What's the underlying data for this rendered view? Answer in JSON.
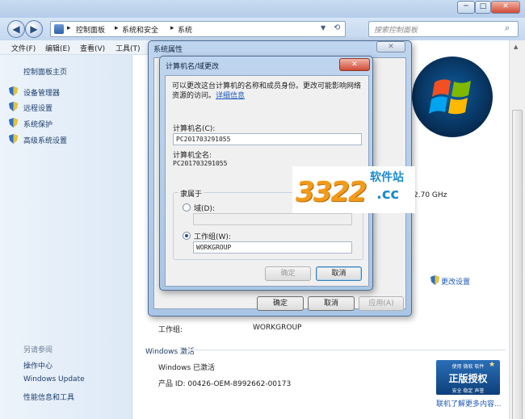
{
  "window": {
    "address_parts": [
      "控制面板",
      "系统和安全",
      "系统"
    ],
    "search_placeholder": "搜索控制面板",
    "min_label": "─",
    "max_label": "□",
    "close_label": "✕"
  },
  "menu": [
    "文件(F)",
    "编辑(E)",
    "查看(V)",
    "工具(T)"
  ],
  "sidebar": {
    "home": "控制面板主页",
    "links": [
      "设备管理器",
      "远程设置",
      "系统保护",
      "高级系统设置"
    ],
    "see_also_title": "另请参阅",
    "see_also": [
      "操作中心",
      "Windows Update",
      "性能信息和工具"
    ]
  },
  "main": {
    "cpu_suffix": "2.70 GHz",
    "change_settings": "更改设置",
    "workgroup_label": "工作组:",
    "workgroup_value": "WORKGROUP",
    "activation_heading": "Windows 激活",
    "activation_status": "Windows 已激活",
    "product_id": "产品 ID: 00426-OEM-8992662-00173",
    "genuine_badge_top": "使用 微软 软件",
    "genuine_badge_main": "正版授权",
    "genuine_badge_bottom": "安全 稳定 声誉",
    "genuine_link": "联机了解更多内容..."
  },
  "system_properties": {
    "title": "系统属性",
    "ok": "确定",
    "cancel": "取消",
    "apply": "应用(A)"
  },
  "rename_dialog": {
    "title": "计算机名/域更改",
    "description": "可以更改这台计算机的名称和成员身份。更改可能影响网络资源的访问。",
    "details_link": "详细信息",
    "name_label": "计算机名(C):",
    "name_value": "PC201703291055",
    "full_name_label": "计算机全名:",
    "full_name_value": "PC201703291055",
    "member_of_label": "隶属于",
    "domain_label": "域(D):",
    "domain_value": "",
    "workgroup_label": "工作组(W):",
    "workgroup_value": "WORKGROUP",
    "ok": "确定",
    "cancel": "取消",
    "close_label": "✕"
  },
  "watermark": {
    "digits": "3322",
    "cn_text": "软件站",
    "domain_text": ".cc"
  },
  "colors": {
    "link": "#1b58b8",
    "sidebar_text": "#1b3d6b",
    "watermark_orange": "#f29a1a",
    "watermark_blue": "#1a8ad0"
  }
}
